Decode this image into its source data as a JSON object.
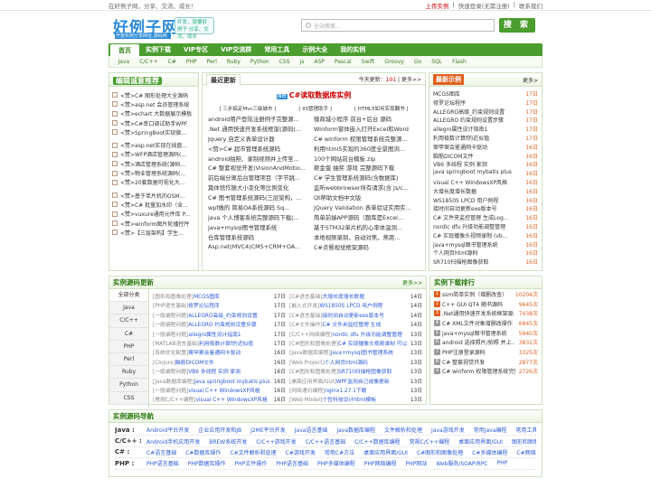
{
  "top": {
    "left": "在好例子网，分享、交流、成长！",
    "upload": "上传实例",
    "login": "快速登录(无需注册)",
    "contact": "联系我们"
  },
  "header": {
    "logo": "好例子网",
    "logo_url": "开放实例分享网址,源码网",
    "slogan": "开发，就要好例子 分享、交流，成长",
    "search_placeholder": "全站搜索...",
    "search_button": "搜 索"
  },
  "nav": [
    "首页",
    "实例下载",
    "VIP专区",
    "VIP交流群",
    "常用工具",
    "示例大全",
    "我的实例"
  ],
  "subnav": [
    "Java",
    "C/C++",
    "C#",
    "PHP",
    "Perl",
    "Ruby",
    "Python",
    "CSS",
    "js",
    "ASP",
    "Pascal",
    "Swift",
    "Groovy",
    "Go",
    "SQL",
    "Flash"
  ],
  "left": {
    "title": "编辑诚意推荐",
    "items": [
      "<赞>C# 图形处理大全源码",
      "<赞>asp.net 会员管理系统",
      "<赞>echart 大数据展示模板",
      "<赞>C#串口调试助手WPF",
      "<赞>SpringBoot实现微...",
      "<赞>asp.net实现在线盘...",
      "<赞>WFP酒店管理源码(...",
      "<赞>酒店管理系统(源码...",
      "<赞>物业管理系统源码(...",
      "<赞>20套数据可视化大...",
      "<赞>基于单片机的GSM...",
      "<赞>C# 批量加水印（含...",
      "<赞>vuxure通用元件库 P...",
      "<赞>winform图片轮播控件",
      "<赞>【三层架构】学生..."
    ]
  },
  "middle": {
    "tab": "最近更新",
    "count_label": "今天更新：",
    "count": "101",
    "more": "更多>>",
    "feature_tag": "推荐",
    "feature": "C#读取数据库实例",
    "feature2": [
      "[ 三步搞定Mvc三级城市 ]",
      "[ IIS管理助手 ]",
      "[ HTML5如何实现翻书 ]"
    ],
    "items": [
      "android用户登陆注册例子完整源...",
      "微商城小程序 前台+后台 源码",
      ".Net 通用快速开发系统框架(源码(...",
      "Winform窗体嵌入打开Excel和Word",
      "Jquery 自定义表单设计器",
      "C# winform 权限管理系统完整源...",
      "<赞>C# 超市管理系统源码",
      "利用html5实现的360度全景图浏...",
      "android拍照、录制视频并上传至...",
      "100个网站前台模板.zip",
      "C# 整套视觉开发(VisionAndMotio...",
      "砸金蛋 抽奖 游戏 完整源码下载",
      "前后端分离后台管理项目（字节跳...",
      "C# 学生管理系统源码(含数据库)",
      "篇体馆作随大小变化等比例变化",
      "监听webbrowser所有请求(含 js/c...",
      "C# 图书管理系统源码(三层架构，...",
      "Qt帮助文档中文版",
      "wpf做的 简易OA系统源码 Sq...",
      "jQuery Validation 表单验证实用实...",
      "java 个人博客系统完整源码下载(...",
      "简单前端APP源码（题库是Excel...",
      "java+mysql图书管理系统",
      "基于STM32单片机的心率体温测...",
      "仓库管理系统源码",
      "本地视频录制，自动对焦，焦距...",
      "Asp.net(MVC4)CMS+CRM+OA...",
      "C#点餐视觉框架源码"
    ]
  },
  "right": {
    "title": "最新示例",
    "more": "更多>",
    "items": [
      [
        "MCGS图库",
        "17日"
      ],
      [
        "修罗论坛程序",
        "17日"
      ],
      [
        "ALLEGRO高级_约束规则设置",
        "17日"
      ],
      [
        "ALLEGRO 约束规则设置步骤",
        "17日"
      ],
      [
        "allegro属性设计指南1",
        "17日"
      ],
      [
        "利用极数计算f的近似值",
        "17日"
      ],
      [
        "案甲案会鉴通网卡驱动",
        "16日"
      ],
      [
        "脑筋DICOM文件",
        "16日"
      ],
      [
        "VB6 多线程 实例 家测",
        "16日"
      ],
      [
        "java springboot mybatis plus",
        "16日"
      ],
      [
        "visual C++ WindowsXP风格",
        "16日"
      ],
      [
        "大增长度增长数据",
        "16日"
      ],
      [
        "WS1850S LPCD 用户例程",
        "16日"
      ],
      [
        "接时间自动更新exe版本号",
        "16日"
      ],
      [
        "C# 文件夹监控管理 生成Log...",
        "16日"
      ],
      [
        "nordic dfu 升级功能调整管理",
        "16日"
      ],
      [
        "C# 实现播像头视频录制 (vb...",
        "16日"
      ],
      [
        "java+mysql图书管理系统",
        "16日"
      ],
      [
        "个人网页html源码",
        "16日"
      ],
      [
        "SR710扫描枪图像获取",
        "16日"
      ]
    ]
  },
  "section2": {
    "title": "实例源码更新",
    "more": "更多>>",
    "tabs": [
      "全部分类",
      "Java",
      "C/C++",
      "C#",
      "PHP",
      "Perl",
      "Ruby",
      "Python",
      "CSS"
    ],
    "items": [
      [
        "[图形和图像处理]",
        "MCGS图库",
        "17日"
      ],
      [
        "[C#语言基础]",
        "大增长度增长数据",
        "14日"
      ],
      [
        "[PHP语言基础]",
        "修罗论坛程序",
        "17日"
      ],
      [
        "[嵌入式开发]",
        "WS1850S LPCD 用户例程",
        "14日"
      ],
      [
        "[一般编程问题]",
        "ALLEGRO高级_约束规则设置",
        "17日"
      ],
      [
        "[C#语言基础]",
        "接时间自动更新exe版本号",
        "14日"
      ],
      [
        "[一般编程问题]",
        "ALLEGRO 约束规则设置步骤",
        "17日"
      ],
      [
        "[C#文件操作]",
        "C# 文件夹监控管理 生成",
        "14日"
      ],
      [
        "[一般编程问题]",
        "allegro属性设计指南1",
        "17日"
      ],
      [
        "[C/C++网络编程]",
        "nordic dfu 升级功能调整管理",
        "13日"
      ],
      [
        "[MATLAB语言基础]",
        "利用极数计算f的近似值",
        "17日"
      ],
      [
        "[C#图形和图像处理]",
        "C# 实现播像头视频录制 可以",
        "13日"
      ],
      [
        "[系统优化配置]",
        "案甲案会鉴通网卡驱动",
        "16日"
      ],
      [
        "[Java数据库编程]",
        "java+mysql图书管理系统",
        "13日"
      ],
      [
        "[Clojure]",
        "脑筋DICOM文件",
        "16日"
      ],
      [
        "[Web Project]",
        "个人网页html源码",
        "13日"
      ],
      [
        "[一般编程问题]",
        "VB6 多线程 实例 家测",
        "16日"
      ],
      [
        "[C#图形和图像处理]",
        "SR710扫描枪图像获取",
        "13日"
      ],
      [
        "[Java数据库编程]",
        "java springboot mybatis plus",
        "16日"
      ],
      [
        "[桌面应用界面/GUI]",
        "WPF监测自己成像更新",
        "13日"
      ],
      [
        "[一般编程问题]",
        "visual C++ WindowsXP风格",
        "16日"
      ],
      [
        "[网络通讯编程]",
        "nginx1.27.1下载",
        "13日"
      ],
      [
        "[常规C/C++编程]",
        "visual C++ WindowsXP风格",
        "16日"
      ],
      [
        "[Web Model]",
        "个性科技设计html模板",
        "13日"
      ]
    ]
  },
  "ranking": {
    "title": "实例下载排行",
    "items": [
      [
        "ssm简单实例（增删改查）",
        "10204",
        "次"
      ],
      [
        "C++ GUI QT4 随书源码",
        "9645",
        "次"
      ],
      [
        ".Net通用快速开发系统框架源...",
        "7438",
        "次"
      ],
      [
        "C# XML文件对象增删改操作",
        "6845",
        "次"
      ],
      [
        "java+mysql图书管理系统",
        "5940",
        "次"
      ],
      [
        "android 选择照片/拍照 并上...",
        "3831",
        "次"
      ],
      [
        "PHP注册登录源码",
        "3325",
        "次"
      ],
      [
        "C# 整套视觉开发",
        "2877",
        "次"
      ],
      [
        "C# winform 权限管理系统完整",
        "2726",
        "次"
      ]
    ]
  },
  "section3": {
    "title": "实例源码导航",
    "lines": [
      [
        "Java :",
        "Android平台开发",
        "企业应用开发和JB",
        "J2ME平台开发",
        "Java语言基础",
        "Java数据库编程",
        "文件解析和处理",
        "Java游戏开发",
        "常用Java编程",
        "常用工具方法"
      ],
      [
        "C/C++ :",
        "Android手机应用开发",
        "BREW系统开发",
        "C/C++游戏开发",
        "C/C++语言基础",
        "C/C++数据库编程",
        "常规C/C++编程",
        "桌面应用界面/GUI",
        "图形和图像处理"
      ],
      [
        "C# :",
        "C#语言基础",
        "C#数据库操作",
        "C#文件解析和处理",
        "C#游戏开发",
        "常用C#方法",
        "桌面应用界面/GUI",
        "C#图形和图像处理",
        "C#多媒体编程",
        "C#网络编"
      ],
      [
        "PHP :",
        "PHP语言基础",
        "PHP数据库操作",
        "PHP文件操作",
        "PHP语言基础",
        "PHP多媒体编程",
        "PHP网络编程",
        "PHP网站",
        "Web服务/SOAP/RPC",
        "PHP"
      ]
    ]
  }
}
